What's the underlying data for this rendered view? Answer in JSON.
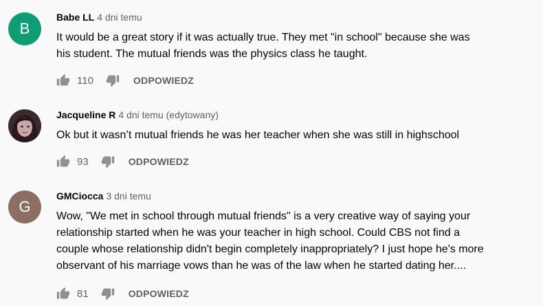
{
  "colors": {
    "avatar_b": "#0f9d76",
    "avatar_g": "#8d6e63",
    "meta_gray": "#606060"
  },
  "comments": [
    {
      "avatar_letter": "B",
      "author": "Babe LL",
      "time": "4 dni temu",
      "text_lines": [
        "It would be a great story if it was actually true. They met \"in school\" because she was",
        "his student. The mutual friends was the physics class he taught."
      ],
      "likes": "110",
      "reply": "ODPOWIEDZ"
    },
    {
      "avatar_letter": "",
      "author": "Jacqueline R",
      "time": "4 dni temu (edytowany)",
      "text_lines": [
        "Ok but it wasn’t mutual friends he was her teacher when she was still in highschool"
      ],
      "likes": "93",
      "reply": "ODPOWIEDZ"
    },
    {
      "avatar_letter": "G",
      "author": "GMCiocca",
      "time": "3 dni temu",
      "text_lines": [
        "Wow, \"We met in school through mutual friends\" is a very creative way of saying your",
        "relationship started when he was your teacher in high school. Could CBS not find a",
        "couple whose relationship didn't begin completely inappropriately? I just hope he's more",
        "observant of his marriage vows than he was of the law when he started dating her...."
      ],
      "likes": "81",
      "reply": "ODPOWIEDZ"
    }
  ],
  "icons": {
    "like": "thumb-up-icon",
    "dislike": "thumb-down-icon"
  }
}
